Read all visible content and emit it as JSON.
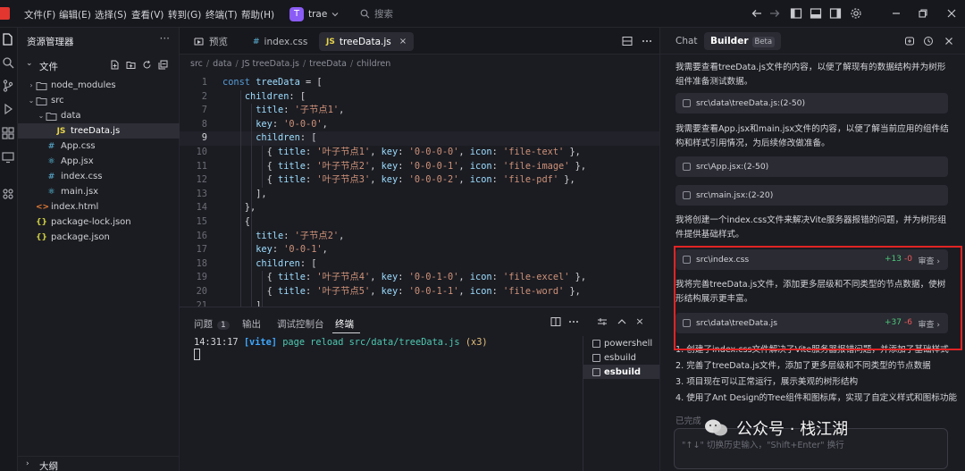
{
  "menu": [
    "文件(F)",
    "编辑(E)",
    "选择(S)",
    "查看(V)",
    "转到(G)",
    "终端(T)",
    "帮助(H)"
  ],
  "project": {
    "badge": "T",
    "name": "trae"
  },
  "search": {
    "placeholder": "搜索"
  },
  "explorer": {
    "title": "资源管理器",
    "more": "···",
    "files_label": "文件",
    "items": [
      {
        "chevron": "›",
        "icon": "folder",
        "badge": "",
        "label": "node_modules"
      },
      {
        "chevron": "⌄",
        "icon": "folder",
        "badge": "",
        "label": "src"
      },
      {
        "chevron": "⌄",
        "icon": "folder",
        "badge": "",
        "label": "data"
      },
      {
        "chevron": "",
        "icon": "js",
        "badge": "JS",
        "label": "treeData.js"
      },
      {
        "chevron": "",
        "icon": "hash",
        "badge": "#",
        "label": "App.css"
      },
      {
        "chevron": "",
        "icon": "react",
        "badge": "⚛",
        "label": "App.jsx"
      },
      {
        "chevron": "",
        "icon": "hash",
        "badge": "#",
        "label": "index.css"
      },
      {
        "chevron": "",
        "icon": "react",
        "badge": "⚛",
        "label": "main.jsx"
      },
      {
        "chevron": "",
        "icon": "html",
        "badge": "<>",
        "label": "index.html"
      },
      {
        "chevron": "",
        "icon": "braces",
        "badge": "{}",
        "label": "package-lock.json"
      },
      {
        "chevron": "",
        "icon": "braces",
        "badge": "{}",
        "label": "package.json"
      }
    ],
    "outline_label": "大纲"
  },
  "editor": {
    "tabs": [
      {
        "icon": "preview",
        "label": "预览"
      },
      {
        "icon": "#",
        "label": "index.css"
      },
      {
        "icon": "JS",
        "label": "treeData.js"
      }
    ],
    "tab_close": "×",
    "breadcrumb": [
      "src",
      "data",
      "JS treeData.js",
      "treeData",
      "children"
    ],
    "lines": [
      {
        "n": "1",
        "text": "const treeData = ["
      },
      {
        "n": "2",
        "text": "    children: ["
      },
      {
        "n": "7",
        "text": "      title: '子节点1',"
      },
      {
        "n": "8",
        "text": "      key: '0-0-0',"
      },
      {
        "n": "9",
        "text": "      children: ["
      },
      {
        "n": "10",
        "text": "        { title: '叶子节点1', key: '0-0-0-0', icon: 'file-text' },"
      },
      {
        "n": "11",
        "text": "        { title: '叶子节点2', key: '0-0-0-1', icon: 'file-image' },"
      },
      {
        "n": "12",
        "text": "        { title: '叶子节点3', key: '0-0-0-2', icon: 'file-pdf' },"
      },
      {
        "n": "13",
        "text": "      ],"
      },
      {
        "n": "14",
        "text": "    },"
      },
      {
        "n": "15",
        "text": "    {"
      },
      {
        "n": "16",
        "text": "      title: '子节点2',"
      },
      {
        "n": "17",
        "text": "      key: '0-0-1',"
      },
      {
        "n": "18",
        "text": "      children: ["
      },
      {
        "n": "19",
        "text": "        { title: '叶子节点4', key: '0-0-1-0', icon: 'file-excel' },"
      },
      {
        "n": "20",
        "text": "        { title: '叶子节点5', key: '0-0-1-1', icon: 'file-word' },"
      },
      {
        "n": "21",
        "text": "      ]"
      }
    ]
  },
  "terminal": {
    "tabs": [
      "问题",
      "输出",
      "调试控制台",
      "终端"
    ],
    "problems_count": "1",
    "log": {
      "time": "14:31:17",
      "tag": "[vite]",
      "msg": "page reload src/data/treeData.js",
      "count": "(x3)"
    },
    "sessions": [
      "powershell",
      "esbuild",
      "esbuild"
    ],
    "close": "×"
  },
  "chat": {
    "tabs": [
      "Chat",
      "Builder"
    ],
    "beta": "Beta",
    "messages": [
      "我需要查看treeData.js文件的内容，以便了解现有的数据结构并为树形组件准备测试数据。",
      "我需要查看App.jsx和main.jsx文件的内容，以便了解当前应用的组件结构和样式引用情况，为后续修改做准备。",
      "我将创建一个index.css文件来解决Vite服务器报错的问题，并为树形组件提供基础样式。",
      "我将完善treeData.js文件，添加更多层级和不同类型的节点数据，使树形结构展示更丰富。"
    ],
    "refs": [
      "src\\data\\treeData.js:(2-50)",
      "src\\App.jsx:(2-50)",
      "src\\main.jsx:(2-20)"
    ],
    "edits": [
      {
        "path": "src\\index.css",
        "add": "+13",
        "del": "-0",
        "review": "审查 ›"
      },
      {
        "path": "src\\data\\treeData.js",
        "add": "+37",
        "del": "-6",
        "review": "审查 ›"
      }
    ],
    "summary": [
      "1. 创建了index.css文件解决了Vite服务器报错问题，并添加了基础样式",
      "2. 完善了treeData.js文件，添加了更多层级和不同类型的节点数据",
      "3. 项目现在可以正常运行，展示美观的树形结构",
      "4. 使用了Ant Design的Tree组件和图标库，实现了自定义样式和图标功能"
    ],
    "done": "已完成",
    "input_placeholder": "\"↑↓\" 切换历史输入，\"Shift+Enter\" 换行"
  },
  "watermark": "公众号 · 栈江湖",
  "colors": {
    "accent": "#8b5cf6",
    "highlight_border": "#e02424",
    "diff_add": "#4ec97a",
    "diff_del": "#f05a5a",
    "logo": "#e2362f"
  }
}
